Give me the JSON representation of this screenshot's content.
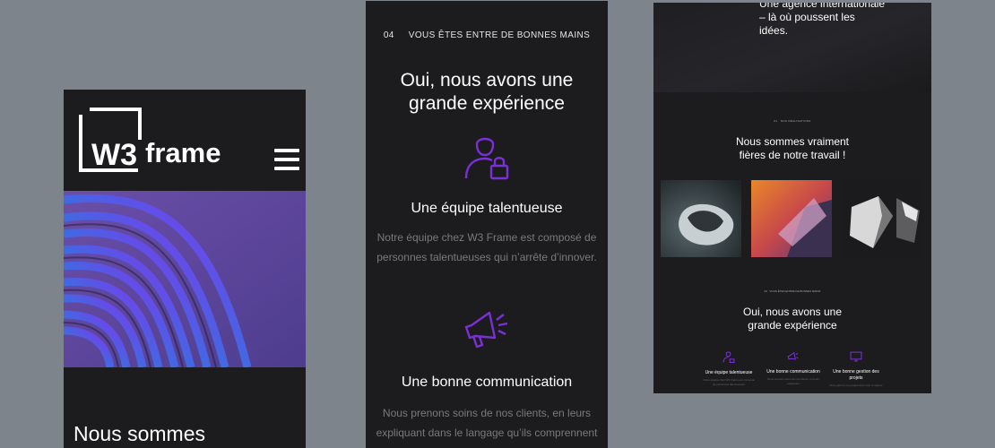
{
  "panel1": {
    "logo_text": "W3frame",
    "title": "Nous sommes"
  },
  "panel2": {
    "eyebrow_num": "04",
    "eyebrow_text": "VOUS ÊTES ENTRE DE BONNES MAINS",
    "heading": "Oui, nous avons une grande expérience",
    "features": [
      {
        "icon": "user-lock-icon",
        "title": "Une équipe talentueuse",
        "desc": "Notre équipe chez W3 Frame est composé de personnes talentueuses qui n’arrête d’innover."
      },
      {
        "icon": "megaphone-icon",
        "title": "Une bonne communication",
        "desc": "Nous prenons soins de nos clients, en leurs expliquant dans le langage qu’ils comprennent le mieux"
      }
    ]
  },
  "panel3": {
    "intro": "Une agence internationale\n– là où poussent les\nidées.",
    "eyebrow1_num": "01",
    "eyebrow1_text": "NOS RÉALISATIONS",
    "heading1": "Nous sommes vraiment fières de notre travail !",
    "eyebrow2_num": "04",
    "eyebrow2_text": "VOUS ÊTES ENTRE DE BONNES MAINS",
    "heading2": "Oui, nous avons une grande expérience",
    "mini_features": [
      {
        "title": "Une équipe talentueuse",
        "desc": "Notre équipe chez W3 Frame est composé de personnes talentueuses"
      },
      {
        "title": "Une bonne communication",
        "desc": "Nous prenons soins de nos clients, en leurs expliquant"
      },
      {
        "title": "Une bonne gestion des projets",
        "desc": "Nous gérons vos projets avec soin et rigueur"
      }
    ]
  },
  "colors": {
    "accent": "#7b2fd6",
    "panel_bg": "#1c1c1e",
    "page_bg": "#7d848b",
    "muted_text": "#7a7a7a"
  }
}
